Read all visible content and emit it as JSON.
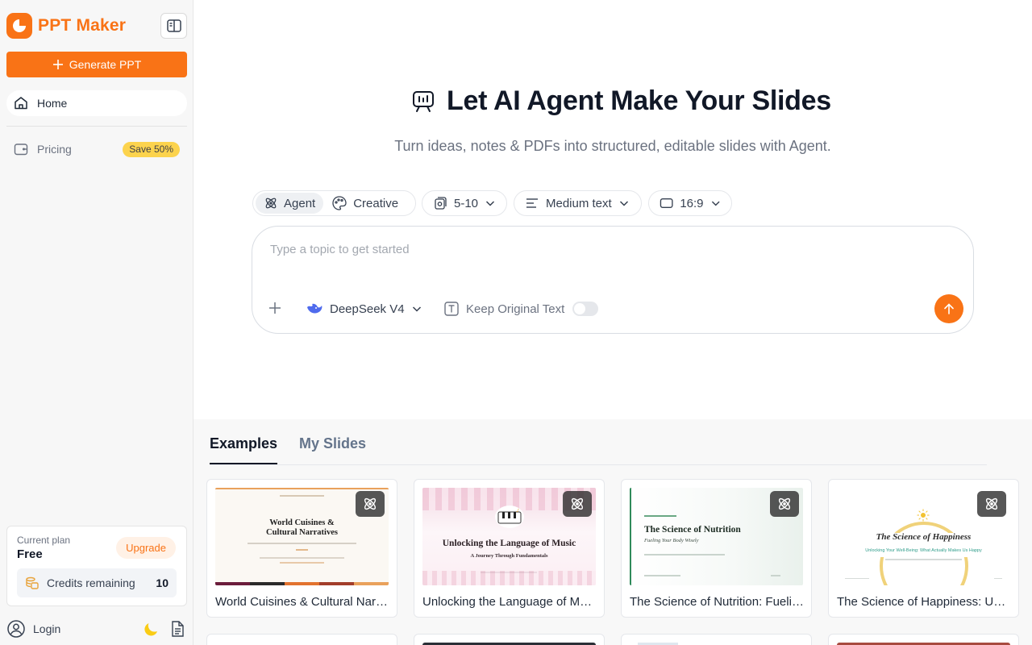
{
  "brand": {
    "name": "PPT Maker"
  },
  "sidebar": {
    "generate_label": "Generate PPT",
    "home_label": "Home",
    "pricing_label": "Pricing",
    "pricing_badge": "Save 50%",
    "plan": {
      "label": "Current plan",
      "name": "Free",
      "upgrade_label": "Upgrade",
      "credits_label": "Credits remaining",
      "credits_value": "10"
    },
    "login_label": "Login"
  },
  "hero": {
    "title": "Let AI Agent Make Your Slides",
    "subtitle": "Turn ideas, notes & PDFs into structured, editable slides with Agent."
  },
  "options": {
    "mode_agent": "Agent",
    "mode_creative": "Creative",
    "slide_count": "5-10",
    "text_amount": "Medium text",
    "aspect_ratio": "16:9"
  },
  "prompt": {
    "placeholder": "Type a topic to get started",
    "model": "DeepSeek V4",
    "keep_text_label": "Keep Original Text"
  },
  "tabs": {
    "examples": "Examples",
    "my_slides": "My Slides"
  },
  "examples": [
    {
      "title": "World Cuisines & Cultural Narratives: Exploring the Stories Behind Food",
      "slide_title_line1": "World Cuisines &",
      "slide_title_line2": "Cultural Narratives"
    },
    {
      "title": "Unlocking the Language of Music: A Journey Through Fundamentals",
      "slide_title_line1": "Unlocking the Language of Music",
      "slide_subtitle": "A Journey Through Fundamentals"
    },
    {
      "title": "The Science of Nutrition: Fueling Your Body Wisely",
      "slide_title_line1": "The Science of Nutrition",
      "slide_subtitle": "Fueling Your Body Wisely"
    },
    {
      "title": "The Science of Happiness: Unlocking Your Well-Being",
      "slide_title_line1": "The Science of Happiness",
      "slide_subtitle": "Unlocking Your Well-Being: What Actually Makes Us Happy"
    }
  ],
  "colors": {
    "accent": "#f97316",
    "badge": "#fcd34d"
  }
}
